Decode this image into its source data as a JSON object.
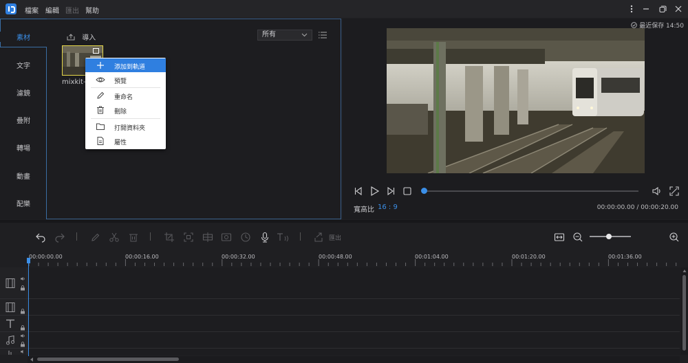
{
  "menu": {
    "file": "檔案",
    "edit": "編輯",
    "export": "匯出",
    "help": "幫助"
  },
  "sidebar": {
    "items": [
      {
        "label": "素材"
      },
      {
        "label": "文字"
      },
      {
        "label": "濾鏡"
      },
      {
        "label": "疊附"
      },
      {
        "label": "轉場"
      },
      {
        "label": "動畫"
      },
      {
        "label": "配樂"
      }
    ]
  },
  "media": {
    "import_label": "導入",
    "filter_selected": "所有",
    "thumb_label": "mixkit-"
  },
  "context_menu": {
    "items": [
      {
        "label": "添加到軌道",
        "icon": "plus-icon"
      },
      {
        "label": "預覽",
        "icon": "eye-icon"
      },
      {
        "label": "重命名",
        "icon": "pencil-icon"
      },
      {
        "label": "刪除",
        "icon": "trash-icon"
      },
      {
        "label": "打開資料夾",
        "icon": "folder-icon"
      },
      {
        "label": "屬性",
        "icon": "file-info-icon"
      }
    ]
  },
  "preview": {
    "save_status": "最近保存 14:50",
    "ratio_label": "寬高比",
    "ratio_value": "16 : 9",
    "time_readout": "00:00:00.00 / 00:00:20.00",
    "progress": 0
  },
  "toolbar": {
    "export_label": "匯出"
  },
  "timeline": {
    "ruler": [
      "00:00:00.00",
      "00:00:16.00",
      "00:00:32.00",
      "00:00:48.00",
      "00:01:04.00",
      "00:01:20.00",
      "00:01:36.00"
    ]
  },
  "colors": {
    "accent": "#3b8fe8",
    "highlight": "#2f7fe0",
    "thumb_border": "#e6d84a"
  }
}
